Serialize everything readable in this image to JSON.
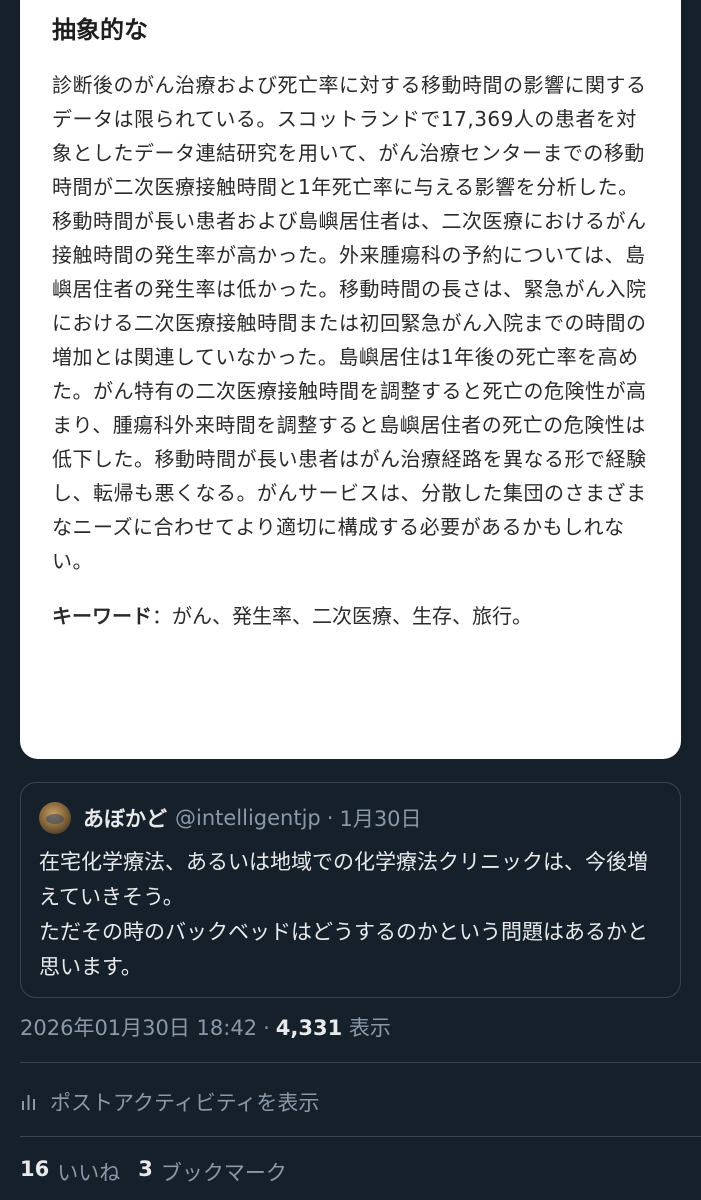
{
  "abstract": {
    "heading": "抽象的な",
    "body": "診断後のがん治療および死亡率に対する移動時間の影響に関するデータは限られている。スコットランドで17,369人の患者を対象としたデータ連結研究を用いて、がん治療センターまでの移動時間が二次医療接触時間と1年死亡率に与える影響を分析した。移動時間が長い患者および島嶼居住者は、二次医療におけるがん接触時間の発生率が高かった。外来腫瘍科の予約については、島嶼居住者の発生率は低かった。移動時間の長さは、緊急がん入院における二次医療接触時間または初回緊急がん入院までの時間の増加とは関連していなかった。島嶼居住は1年後の死亡率を高めた。がん特有の二次医療接触時間を調整すると死亡の危険性が高まり、腫瘍科外来時間を調整すると島嶼居住者の死亡の危険性は低下した。移動時間が長い患者はがん治療経路を異なる形で経験し、転帰も悪くなる。がんサービスは、分散した集団のさまざまなニーズに合わせてより適切に構成する必要があるかもしれない。",
    "keywords_label": "キーワード",
    "keywords": "：がん、発生率、二次医療、生存、旅行。"
  },
  "quote": {
    "name": "あぼかど",
    "handle": "@intelligentjp",
    "separator": "·",
    "date": "1月30日",
    "text": "在宅化学療法、あるいは地域での化学療法クリニックは、今後増えていきそう。\nただその時のバックベッドはどうするのかという問題はあるかと思います。"
  },
  "meta": {
    "timestamp": "2026年01月30日 18:42",
    "separator": "·",
    "views_count": "4,331",
    "views_label": "表示"
  },
  "activity": {
    "label": "ポストアクティビティを表示",
    "icon": "analytics-icon"
  },
  "stats": {
    "likes_count": "16",
    "likes_label": "いいね",
    "bookmarks_count": "3",
    "bookmarks_label": "ブックマーク"
  }
}
